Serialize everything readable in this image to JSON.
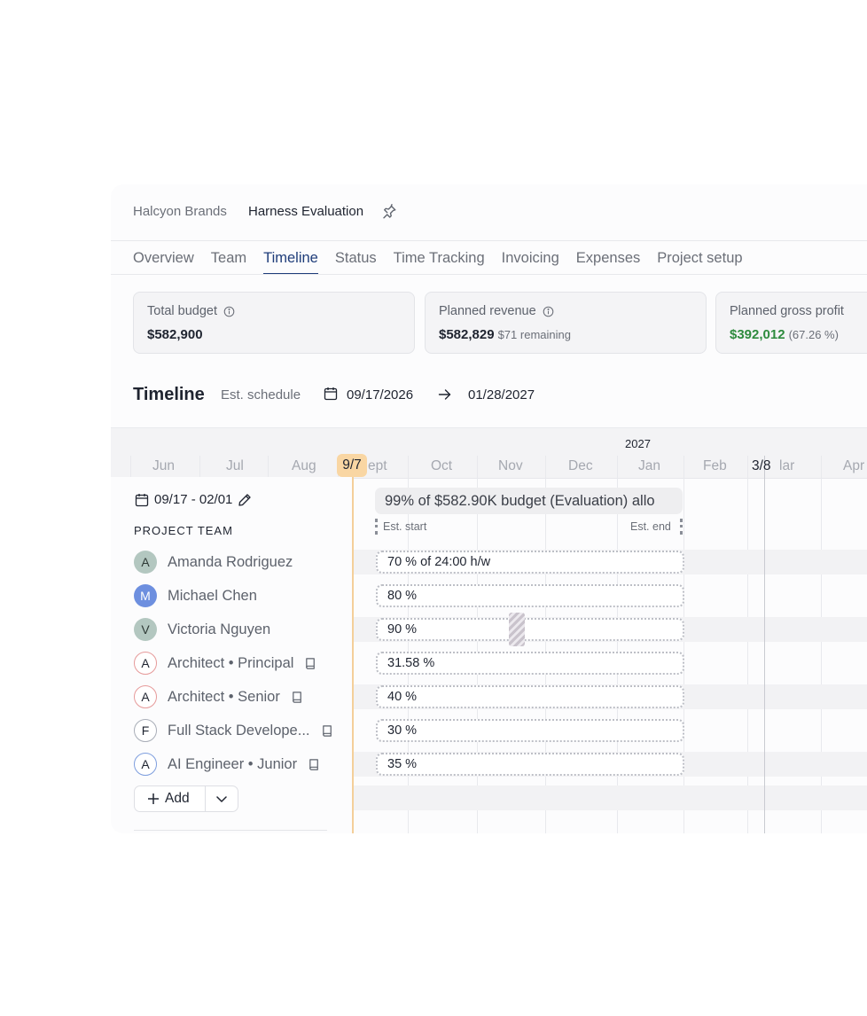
{
  "breadcrumb": {
    "client": "Halcyon Brands",
    "project": "Harness Evaluation",
    "pin_icon": "pin-icon"
  },
  "tabs": [
    {
      "label": "Overview",
      "active": false
    },
    {
      "label": "Team",
      "active": false
    },
    {
      "label": "Timeline",
      "active": true
    },
    {
      "label": "Status",
      "active": false
    },
    {
      "label": "Time Tracking",
      "active": false
    },
    {
      "label": "Invoicing",
      "active": false
    },
    {
      "label": "Expenses",
      "active": false
    },
    {
      "label": "Project setup",
      "active": false
    }
  ],
  "cards": {
    "total_budget": {
      "label": "Total budget",
      "value": "$582,900"
    },
    "planned_revenue": {
      "label": "Planned revenue",
      "value": "$582,829",
      "sub": "$71 remaining"
    },
    "planned_gross_profit": {
      "label": "Planned gross profit",
      "value": "$392,012",
      "sub": "(67.26 %)"
    }
  },
  "timeline": {
    "title": "Timeline",
    "schedule_label": "Est. schedule",
    "start_date": "09/17/2026",
    "end_date": "01/28/2027",
    "year_label": "2027",
    "months": [
      "Jun",
      "Jul",
      "Aug",
      "ept",
      "Oct",
      "Nov",
      "Dec",
      "Jan",
      "Feb",
      "lar",
      "Apr"
    ],
    "today_badge": "9/7",
    "marker_badge": "3/8",
    "range": "09/17 - 02/01",
    "team_heading": "PROJECT TEAM",
    "budget_pill": "99% of $582.90K budget (Evaluation) allo",
    "est_start": "Est. start",
    "est_end": "Est. end"
  },
  "members": [
    {
      "initial": "A",
      "name": "Amanda Rodriguez",
      "style": "teal",
      "allocation": "70 % of 24:00 h/w",
      "has_book": false
    },
    {
      "initial": "M",
      "name": "Michael Chen",
      "style": "blue",
      "allocation": "80 %",
      "has_book": false
    },
    {
      "initial": "V",
      "name": "Victoria Nguyen",
      "style": "teal",
      "allocation": "90 %",
      "has_book": false
    },
    {
      "initial": "A",
      "name": "Architect • Principal",
      "style": "ring-red",
      "allocation": "31.58 %",
      "has_book": true
    },
    {
      "initial": "A",
      "name": "Architect • Senior",
      "style": "ring-red",
      "allocation": "40 %",
      "has_book": true
    },
    {
      "initial": "F",
      "name": "Full Stack Develope...",
      "style": "ring-gray",
      "allocation": "30 %",
      "has_book": true
    },
    {
      "initial": "A",
      "name": "AI Engineer • Junior",
      "style": "ring-blue",
      "allocation": "35 %",
      "has_book": true
    }
  ],
  "add_button": {
    "label": "Add"
  },
  "colors": {
    "accent": "#1f3d7a",
    "today": "#f9d6a3",
    "profit_green": "#2e8b3e"
  }
}
